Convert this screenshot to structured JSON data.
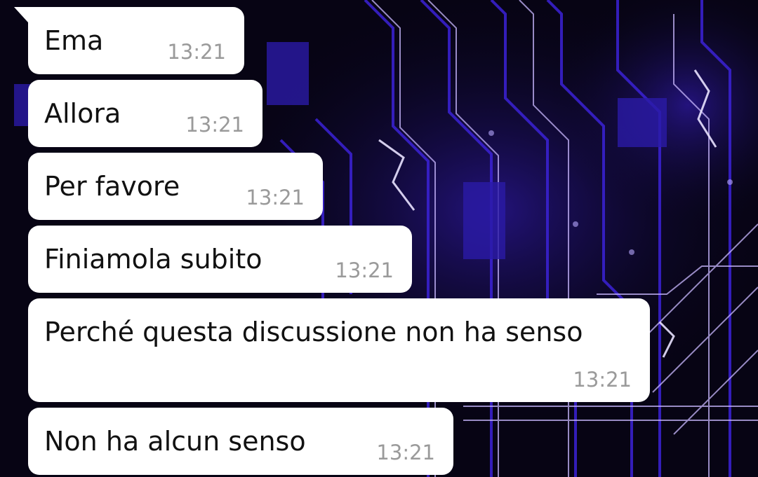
{
  "chat": {
    "wallpaper": {
      "description_icon": "circuit-board-wallpaper",
      "base_color": "#070414",
      "trace_color": "#3b22d6",
      "glow_color": "#c9b8ff"
    },
    "bubble_color": "#ffffff",
    "text_color": "#111111",
    "time_color": "#9a9a9a",
    "messages": [
      {
        "text": "Ema",
        "time": "13:21"
      },
      {
        "text": "Allora",
        "time": "13:21"
      },
      {
        "text": "Per favore",
        "time": "13:21"
      },
      {
        "text": "Finiamola subito",
        "time": "13:21"
      },
      {
        "text": "Perché questa discussione non ha senso",
        "time": "13:21"
      },
      {
        "text": "Non ha alcun senso",
        "time": "13:21"
      }
    ]
  }
}
